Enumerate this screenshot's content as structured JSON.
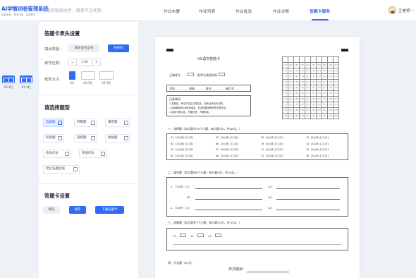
{
  "header": {
    "logo_title": "AI学情词卷管理系统",
    "logo_subtitle": "智能组卷 · 精准分析 · 高效教学",
    "slogan": "| 您的智能助手，随卷不在忧愁",
    "nav": [
      {
        "label": "作业布置",
        "active": false
      },
      {
        "label": "作业列表",
        "active": false
      },
      {
        "label": "作业批改",
        "active": false
      },
      {
        "label": "作业诊断",
        "active": false
      },
      {
        "label": "答题卡服务",
        "active": true
      }
    ],
    "user_name": "王老师",
    "caret": "▾"
  },
  "rail": [
    {
      "label": "A3-2栏"
    },
    {
      "label": "A3-3栏"
    }
  ],
  "panel": {
    "header_settings_title": "答题卡表头设置",
    "fill_type_label": "填涂类型:",
    "fill_type_options": [
      "填涂准考证号",
      "条形码"
    ],
    "exam_digits_label": "考号位数:",
    "exam_digits_minus": "−",
    "exam_digits_value": "1.00",
    "exam_digits_plus": "+",
    "paper_size_label": "纸张大小:",
    "paper_sizes": [
      "A4",
      "A3-2栏",
      "A3-3栏"
    ],
    "question_type_title": "请选择题型",
    "question_types": [
      "选择题",
      "判断题",
      "填空题",
      "综合题",
      "选择题",
      "附加题",
      "语文作文",
      "英语作文",
      "禁止答题区域"
    ],
    "card_settings_title": "答题卡设置",
    "actions": [
      "预览",
      "保存",
      "下载答题卡"
    ]
  },
  "document": {
    "title": "XX语文答题卡",
    "exam_no_label": "正确考号",
    "exam_no_hint": "贴考号填涂样例",
    "student_info": "学校__________班级________姓名__________座位号_____",
    "notice_title": "注意事项",
    "notice_lines": [
      "1.答题前，考生先将自己的姓名、准考证号填写清楚。",
      "2.选择题使用2B铅笔填涂，非选择题用黑色签字笔作答。",
      "3.保持卡面清洁，不要折叠、不要弄破。"
    ],
    "id_grid_digits": [
      "0",
      "1",
      "2",
      "3",
      "4",
      "5",
      "6",
      "7",
      "8",
      "9"
    ],
    "section1": "一、选择题（本大题共16个小题，每小题3分，共48分。）",
    "choice_rows": [
      [
        "01 [A][B][C][D]",
        "05 [A][B][C][D]",
        "09 [A][B][C][D]",
        "13 [A][B][C][D]"
      ],
      [
        "02 [A][B][C][D]",
        "06 [A][B][C][D]",
        "10 [A][B][C][D]",
        "14 [A][B][C][D]"
      ],
      [
        "03 [A][B][C][D]",
        "07 [A][B][C][D]",
        "11 [A][B][C][D]",
        "15 [A][B][C][D]"
      ],
      [
        "04 [A][B][C][D]",
        "08 [A][B][C][D]",
        "12 [A][B][C][D]",
        "16 [A][B][C][D]"
      ]
    ],
    "section2": "二、填空题（本大题共6个小题，每小题5分，共30分。）",
    "fill_items": [
      "1.（10分）(1)",
      "(2)",
      "(1)",
      "(2)",
      "2.（10分）(1)",
      "(2)"
    ],
    "section3": "三、选做题（本大题共1个小题，每小题10分，共10分。）",
    "elective_options": [
      "20",
      "21",
      "22"
    ],
    "section4": "四、作文题（60分）",
    "essay_title_label": "作文题目："
  }
}
